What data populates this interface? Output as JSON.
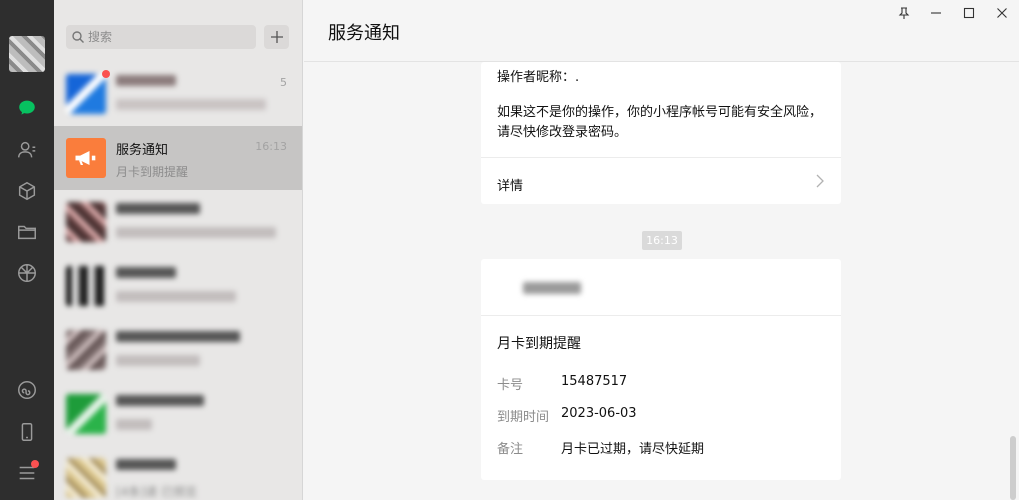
{
  "search": {
    "placeholder": "搜索"
  },
  "chats": [
    {
      "name": "",
      "preview": "",
      "time": "5"
    },
    {
      "name": "服务通知",
      "preview": "月卡到期提醒",
      "time": "16:13"
    },
    {
      "name": "",
      "preview": "",
      "time": ""
    },
    {
      "name": "",
      "preview": "",
      "time": ""
    },
    {
      "name": "",
      "preview": "",
      "time": ""
    },
    {
      "name": "",
      "preview": "",
      "time": ""
    },
    {
      "name": "",
      "preview": "[4条]请 已预览",
      "time": ""
    }
  ],
  "window": {
    "title": "服务通知"
  },
  "message1": {
    "operator_line": "操作者昵称：.",
    "warning": "如果这不是你的操作，你的小程序帐号可能有安全风险，请尽快修改登录密码。",
    "detail_label": "详情"
  },
  "time_badge": "16:13",
  "message2": {
    "title": "月卡到期提醒",
    "rows": [
      {
        "label": "卡号",
        "value": "15487517"
      },
      {
        "label": "到期时间",
        "value": "2023-06-03"
      },
      {
        "label": "备注",
        "value": "月卡已过期，请尽快延期"
      }
    ]
  },
  "colors": {
    "accent": "#07c160",
    "notify_orange": "#fa7d3c",
    "badge_red": "#fa5151",
    "rail": "#2e2e2e"
  }
}
